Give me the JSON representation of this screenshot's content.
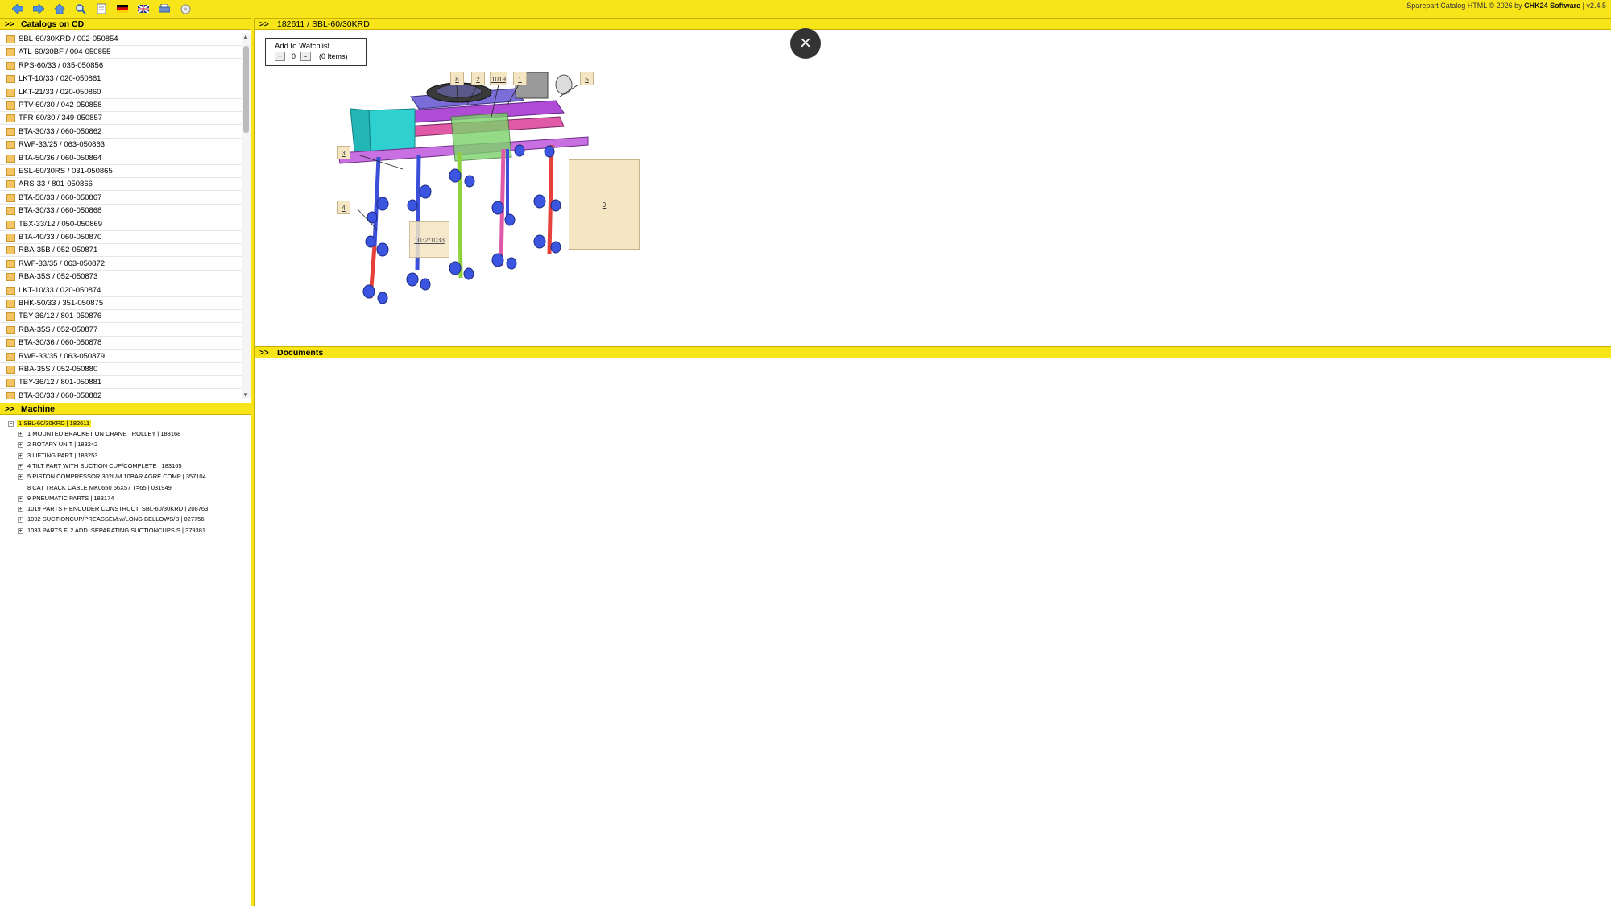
{
  "toolbar": {
    "icons": [
      "arrow-left-icon",
      "arrow-right-icon",
      "home-icon",
      "search-icon",
      "document-icon",
      "flag-de-icon",
      "flag-uk-icon",
      "print-icon",
      "help-icon"
    ],
    "copyright_prefix": "Sparepart Catalog HTML © 2026 by ",
    "copyright_brand": "CHK24 Software",
    "copyright_version": " | v2.4.5"
  },
  "catalogs": {
    "title": "Catalogs on CD",
    "items": [
      "SBL-60/30KRD / 002-050854",
      "ATL-60/30BF / 004-050855",
      "RPS-60/33 / 035-050856",
      "LKT-10/33 / 020-050861",
      "LKT-21/33 / 020-050860",
      "PTV-60/30 / 042-050858",
      "TFR-60/30 / 349-050857",
      "BTA-30/33 / 060-050862",
      "RWF-33/25 / 063-050863",
      "BTA-50/36 / 060-050864",
      "ESL-60/30RS / 031-050865",
      "ARS-33 / 801-050866",
      "BTA-50/33 / 060-050867",
      "BTA-30/33 / 060-050868",
      "TBX-33/12 / 050-050869",
      "BTA-40/33 / 060-050870",
      "RBA-35B / 052-050871",
      "RWF-33/35 / 063-050872",
      "RBA-35S / 052-050873",
      "LKT-10/33 / 020-050874",
      "BHK-50/33 / 351-050875",
      "TBY-36/12 / 801-050876",
      "RBA-35S / 052-050877",
      "BTA-30/36 / 060-050878",
      "RWF-33/35 / 063-050879",
      "RBA-35S / 052-050880",
      "TBY-36/12 / 801-050881",
      "BTA-30/33 / 060-050882"
    ]
  },
  "machine": {
    "title": "Machine",
    "root": "1 SBL-60/30KRD | 182611",
    "children": [
      {
        "label": "1 MOUNTED BRACKET ON CRANE TROLLEY | 183168",
        "expandable": true
      },
      {
        "label": "2 ROTARY UNIT | 183242",
        "expandable": true
      },
      {
        "label": "3 LIFTING PART | 183253",
        "expandable": true
      },
      {
        "label": "4 TILT PART WITH SUCTION CUP/COMPLETE | 183165",
        "expandable": true
      },
      {
        "label": "5 PISTON COMPRESSOR 302L/M 10BAR AGRE COMP | 357104",
        "expandable": true
      },
      {
        "label": "8 CAT TRACK CABLE MK0650 66X57 T=65 | 031949",
        "expandable": false
      },
      {
        "label": "9 PNEUMATIC PARTS | 183174",
        "expandable": true
      },
      {
        "label": "1019 PARTS F ENCODER CONSTRUCT. SBL-60/30KRD | 208763",
        "expandable": true
      },
      {
        "label": "1032 SUCTIONCUP/PREASSEM.w/LONG BELLOWS/B | 027756",
        "expandable": true
      },
      {
        "label": "1033 PARTS F. 2 ADD. SEPARATING SUCTIONCUPS S | 379381",
        "expandable": true
      }
    ]
  },
  "drawing": {
    "title": "182611 / SBL-60/30KRD",
    "watchlist_title": "Add to Watchlist",
    "plus": "+",
    "minus": "-",
    "quantity": "0",
    "items_count": "(0 Items)",
    "close_label": "×",
    "callouts": [
      "8",
      "2",
      "1019",
      "1",
      "5",
      "3",
      "4",
      "9",
      "1032/1033"
    ]
  },
  "documents": {
    "title": "Documents"
  },
  "colors": {
    "accent": "#f7e51a",
    "tree_selected": "#f7e51a",
    "callout_fill": "#f5e6c3"
  }
}
